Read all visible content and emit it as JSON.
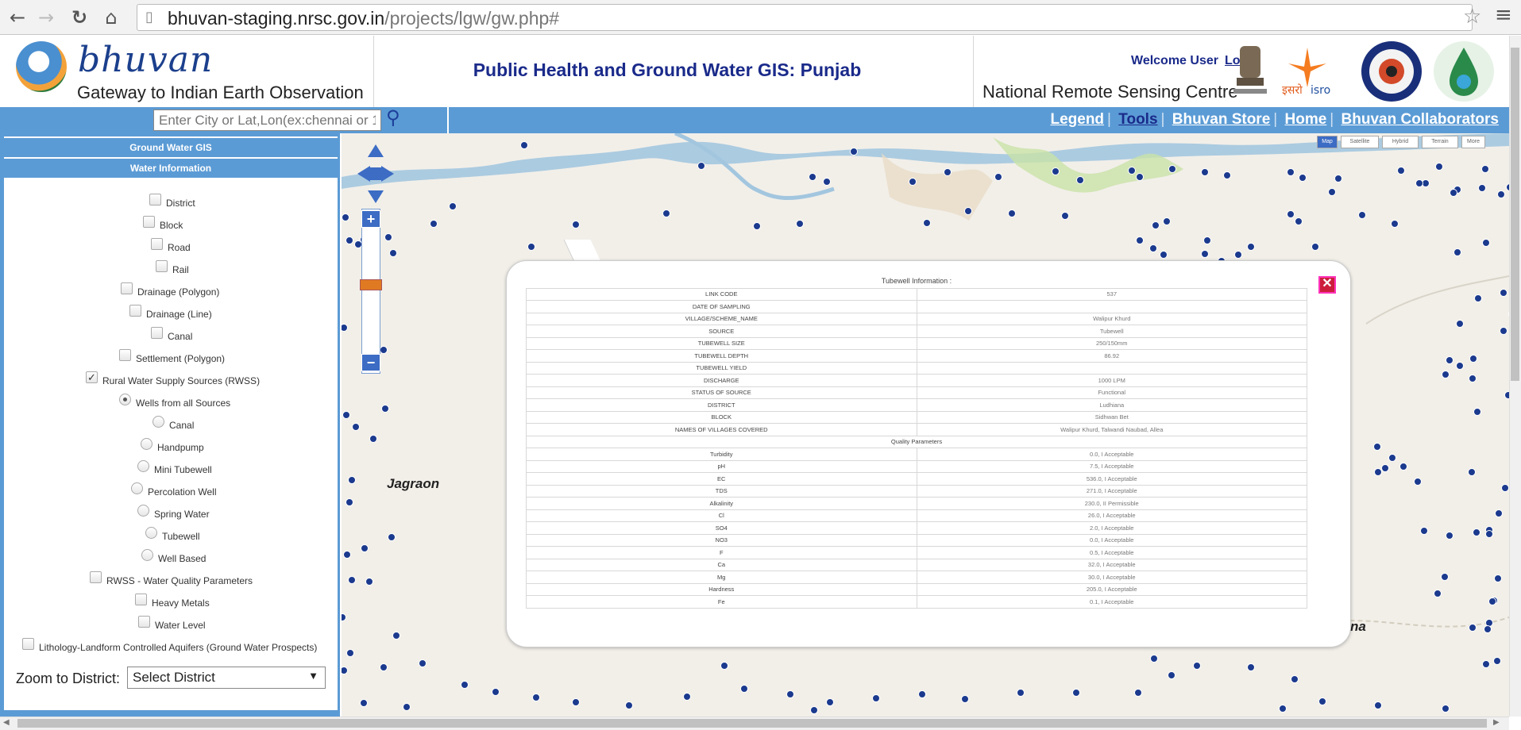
{
  "browser": {
    "url_host": "bhuvan-staging.nrsc.gov.in",
    "url_path": "/projects/lgw/gw.php#",
    "back_icon": "arrow-left-icon",
    "forward_icon": "arrow-right-icon",
    "reload_icon": "reload-icon",
    "home_icon": "home-icon",
    "star_icon": "star-icon",
    "menu_icon": "hamburger-menu-icon"
  },
  "header": {
    "logo_word": "bhuvan",
    "logo_tagline": "Gateway to Indian Earth Observation",
    "app_title": "Public Health and Ground Water GIS: Punjab",
    "welcome": "Welcome User",
    "login": "Login",
    "org": "National Remote Sensing Centre"
  },
  "toolbar": {
    "search_placeholder": "Enter City or Lat,Lon(ex:chennai or 1",
    "links": [
      "Legend",
      "Tools",
      "Bhuvan Store",
      "Home",
      "Bhuvan Collaborators"
    ],
    "map_types": [
      "Map",
      "Satellite",
      "Hybrid",
      "Terrain",
      "More"
    ]
  },
  "sidebar": {
    "section1": "Ground Water GIS",
    "section2": "Water Information",
    "options": [
      {
        "label": "District",
        "type": "checkbox",
        "checked": false
      },
      {
        "label": "Block",
        "type": "checkbox",
        "checked": false
      },
      {
        "label": "Road",
        "type": "checkbox",
        "checked": false
      },
      {
        "label": "Rail",
        "type": "checkbox",
        "checked": false
      },
      {
        "label": "Drainage (Polygon)",
        "type": "checkbox",
        "checked": false
      },
      {
        "label": "Drainage (Line)",
        "type": "checkbox",
        "checked": false
      },
      {
        "label": "Canal",
        "type": "checkbox",
        "checked": false
      },
      {
        "label": "Settlement (Polygon)",
        "type": "checkbox",
        "checked": false
      },
      {
        "label": "Rural Water Supply Sources (RWSS)",
        "type": "checkbox",
        "checked": true
      },
      {
        "label": "Wells from all Sources",
        "type": "radio",
        "checked": true
      },
      {
        "label": "Canal",
        "type": "radio",
        "checked": false
      },
      {
        "label": "Handpump",
        "type": "radio",
        "checked": false
      },
      {
        "label": "Mini Tubewell",
        "type": "radio",
        "checked": false
      },
      {
        "label": "Percolation Well",
        "type": "radio",
        "checked": false
      },
      {
        "label": "Spring Water",
        "type": "radio",
        "checked": false
      },
      {
        "label": "Tubewell",
        "type": "radio",
        "checked": false
      },
      {
        "label": "Well Based",
        "type": "radio",
        "checked": false
      },
      {
        "label": "RWSS - Water Quality Parameters",
        "type": "checkbox",
        "checked": false
      },
      {
        "label": "Heavy Metals",
        "type": "checkbox",
        "checked": false
      },
      {
        "label": "Water Level",
        "type": "checkbox",
        "checked": false
      },
      {
        "label": "Lithology-Landform Controlled Aquifers (Ground Water Prospects)",
        "type": "checkbox",
        "checked": false
      }
    ],
    "zoom_label": "Zoom to District:",
    "zoom_value": "Select District"
  },
  "map": {
    "city_labels": [
      "Jagraon",
      "na"
    ],
    "zoom_in": "+",
    "zoom_out": "−"
  },
  "popup": {
    "title": "Tubewell Information :",
    "close_icon": "close-icon",
    "rows": [
      [
        "LINK CODE",
        "537"
      ],
      [
        "DATE OF SAMPLING",
        ""
      ],
      [
        "VILLAGE/SCHEME_NAME",
        "Walipur Khurd"
      ],
      [
        "SOURCE",
        "Tubewell"
      ],
      [
        "TUBEWELL SIZE",
        "250/150mm"
      ],
      [
        "TUBEWELL DEPTH",
        "86.92"
      ],
      [
        "TUBEWELL YIELD",
        ""
      ],
      [
        "DISCHARGE",
        "1000 LPM"
      ],
      [
        "STATUS OF SOURCE",
        "Functional"
      ],
      [
        "DISTRICT",
        "Ludhiana"
      ],
      [
        "BLOCK",
        "Sidhwan Bet"
      ],
      [
        "NAMES OF VILLAGES COVERED",
        "Walipur Khurd, Talwandi Naubad, Allea"
      ]
    ],
    "quality_header": "Quality Parameters",
    "quality_rows": [
      [
        "Turbidity",
        "0.0, I Acceptable"
      ],
      [
        "pH",
        "7.5, I Acceptable"
      ],
      [
        "EC",
        "536.0, I Acceptable"
      ],
      [
        "TDS",
        "271.0, I Acceptable"
      ],
      [
        "Alkalinity",
        "230.0, II Permissible"
      ],
      [
        "Cl",
        "26.0, I Acceptable"
      ],
      [
        "SO4",
        "2.0, I Acceptable"
      ],
      [
        "NO3",
        "0.0, I Acceptable"
      ],
      [
        "F",
        "0.5, I Acceptable"
      ],
      [
        "Ca",
        "32.0, I Acceptable"
      ],
      [
        "Mg",
        "30.0, I Acceptable"
      ],
      [
        "Hardness",
        "205.0, I Acceptable"
      ],
      [
        "Fe",
        "0.1, I Acceptable"
      ]
    ]
  }
}
